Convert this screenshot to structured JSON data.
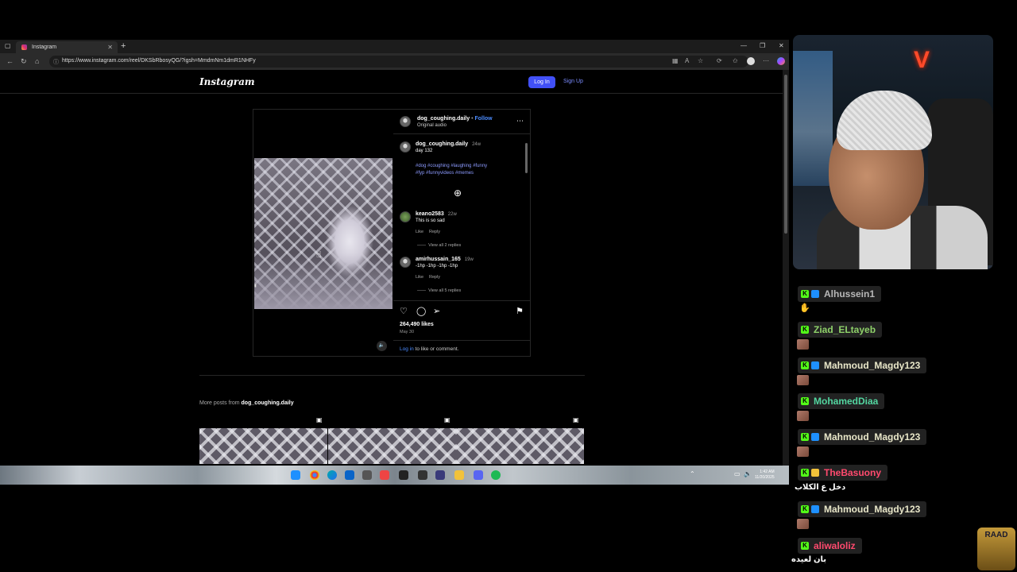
{
  "browser": {
    "tab_title": "Instagram",
    "url": "https://www.instagram.com/reel/DKSbRbosyQG/?igsh=MmdmNm1dmR1NHFy"
  },
  "instagram": {
    "logo": "Instagram",
    "login_button": "Log In",
    "signup_link": "Sign Up",
    "post": {
      "username": "dog_coughing.daily",
      "follow_separator": " • ",
      "follow_label": "Follow",
      "audio": "Original audio",
      "caption_user": "dog_coughing.daily",
      "caption_age": "24w",
      "caption_text": "day 132",
      "hashtags_line1": "#dog #coughing #laughing #funny",
      "hashtags_line2": "#fyp #funnyvideos #memes",
      "comments": [
        {
          "user": "keano2583",
          "age": "22w",
          "text": "This is so sad",
          "like": "Like",
          "reply": "Reply",
          "replies": "View all 2 replies"
        },
        {
          "user": "amirhussain_165",
          "age": "19w",
          "text": "-1hp -1hp -1hp -1hp",
          "like": "Like",
          "reply": "Reply",
          "replies": "View all 5 replies"
        }
      ],
      "likes": "264,490 likes",
      "date": "May 30",
      "login_link": "Log in",
      "login_suffix": " to like or comment."
    },
    "more_posts_prefix": "More posts from ",
    "more_posts_user": "dog_coughing.daily"
  },
  "taskbar": {
    "time": "1:42 AM",
    "date": "11/20/2025"
  },
  "chat": [
    {
      "user": "Alhussein1",
      "color": "#b8b8b8"
    },
    {
      "user": "Ziad_ELtayeb",
      "color": "#8fd16a"
    },
    {
      "user": "Mahmoud_Magdy123",
      "color": "#e8e6c8"
    },
    {
      "user": "MohamedDiaa",
      "color": "#53d6a0"
    },
    {
      "user": "Mahmoud_Magdy123",
      "color": "#e8e6c8"
    },
    {
      "user": "TheBasuony",
      "color": "#ff4a6e"
    },
    {
      "user": "Mahmoud_Magdy123",
      "color": "#e8e6c8"
    },
    {
      "user": "aliwaloliz",
      "color": "#ff4a6e"
    }
  ],
  "chat_messages": {
    "basuony_msg": "دخل ع الكلاب",
    "aliwaloliz_msg": "بان لعيده"
  },
  "overlay": {
    "raad_logo": "RAAD"
  }
}
